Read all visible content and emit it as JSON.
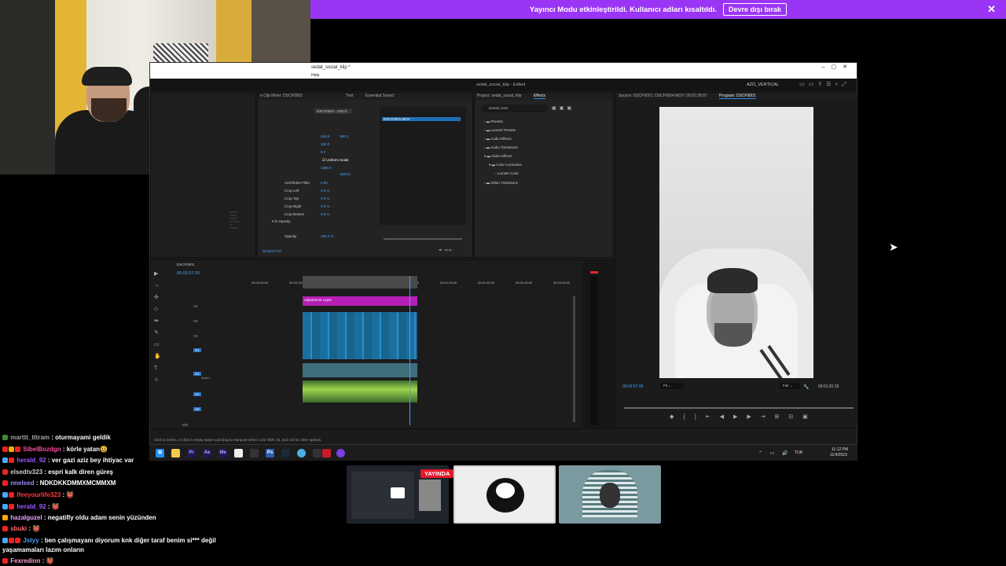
{
  "banner": {
    "message": "Yayıncı Modu etkinleştirildi. Kullanıcı adları kısaltıldı.",
    "button_label": "Devre dışı bırak",
    "close_glyph": "✕"
  },
  "premiere": {
    "title": "sedat_social_klip *",
    "menu_help": "Help",
    "project_title": "sedat_social_klip - Edited",
    "workspace_label": "AZO_VERTICAL",
    "left_panel": {
      "tabs": [
        "e Clip Mixer: DSCF0001",
        "Text",
        "Essential Sound"
      ],
      "clip_name": "DSCF0001 - DSCF...",
      "clip_bar": "DSCF0001.MOV",
      "pos_x": "540.0",
      "pos_y": "960.0",
      "scale": "100.0",
      "rotation": "0.0",
      "anchor_x": "1080.0",
      "anchor_y": "1920.0",
      "uniform_scale": "Uniform Scale",
      "anti_flicker_label": "Anti-flicker Filter",
      "anti_flicker_value": "0.00",
      "crop_left_label": "Crop Left",
      "crop_left_value": "0.0 %",
      "crop_top_label": "Crop Top",
      "crop_top_value": "0.0 %",
      "crop_right_label": "Crop Right",
      "crop_right_value": "0.0 %",
      "crop_bottom_label": "Crop Bottom",
      "crop_bottom_value": "0.0 %",
      "opacity_section": "Opacity",
      "opacity_label": "Opacity",
      "opacity_value": "100.0 %",
      "timecode": "00:02:57:20"
    },
    "effects_panel": {
      "tabs": [
        "Project: sedat_social_klip",
        "Effects"
      ],
      "search_value": "lumetri color",
      "items": [
        "Presets",
        "Lumetri Presets",
        "Audio Effects",
        "Audio Transitions",
        "Video Effects",
        "Color Correction",
        "Lumetri Color",
        "Video Transitions"
      ]
    },
    "program_panel": {
      "tabs": [
        "Source: DSCF0001: DSCF0004.MOV: 00:02:28:07",
        "Program: DSCF0001"
      ],
      "timecode_left": "00:02:57:20",
      "fit_label": "Fit",
      "full_label": "Full",
      "timecode_right": "00:01:31:15"
    },
    "timeline": {
      "sequence_tab": "DSCF0001",
      "timecode": "00:02:57:20",
      "ruler": [
        "00:00:00:00",
        "00:00:15:00",
        "00:00:30:00",
        "00:00:45:00",
        "00:01:00:00",
        "00:01:15:00",
        "00:01:30:00",
        "00:01:45:00",
        "00:02:00:00"
      ],
      "tracks_video": [
        "V4",
        "V3",
        "V2",
        "V1"
      ],
      "tracks_audio": [
        "A1",
        "A2",
        "A3"
      ],
      "audio_track_name": "Audio 1",
      "mix_label": "Mix",
      "mix_value": "0.0",
      "adjustment_layer": "Adjustment Layer"
    },
    "status_bar": "Click to select, or click in empty space and drag to marquee select. Use Shift, Alt, and Ctrl for other options."
  },
  "taskbar": {
    "lang": "TUR",
    "time": "11:12 PM",
    "date": "11/4/2023"
  },
  "thumbnails": {
    "live_label": "YAYINDA"
  },
  "chat": [
    {
      "user": "marttt_tttram",
      "text": ": oturmayami geldik",
      "color": "#a3a3a3"
    },
    {
      "user": "SibelBozdgn",
      "text": ": körle yatan😃",
      "color": "#ff4da6"
    },
    {
      "user": "herald_92",
      "text": ": ver gazi aziz bey ihtiyac var",
      "color": "#a259ff"
    },
    {
      "user": "elsedtv323",
      "text": ": espri kalk diren güreş",
      "color": "#cfcfcf"
    },
    {
      "user": "nnelsed",
      "text": ": NDKDKKDMMXMCMMXM",
      "color": "#9e8cff"
    },
    {
      "user": "lfeeyourlife323",
      "text": ": 👹",
      "color": "#ff3b3b"
    },
    {
      "user": "herald_92",
      "text": ": 👹",
      "color": "#a259ff"
    },
    {
      "user": "hazalguzel",
      "text": ": negatifly oldu adam senin yüzünden",
      "color": "#e8a7ff"
    },
    {
      "user": "sbuki",
      "text": ": 👹",
      "color": "#ff6b6b"
    },
    {
      "user": "Jstyy",
      "text": ": ben çalışmayanı diyorum knk diğer taraf benim si*** değil",
      "color": "#4a9eff"
    },
    {
      "user": "",
      "text": "yaşamamaları lazım onların",
      "color": "#ffffff"
    },
    {
      "user": "Fexredinn",
      "text": ": 👹",
      "color": "#ff9ecf"
    }
  ]
}
